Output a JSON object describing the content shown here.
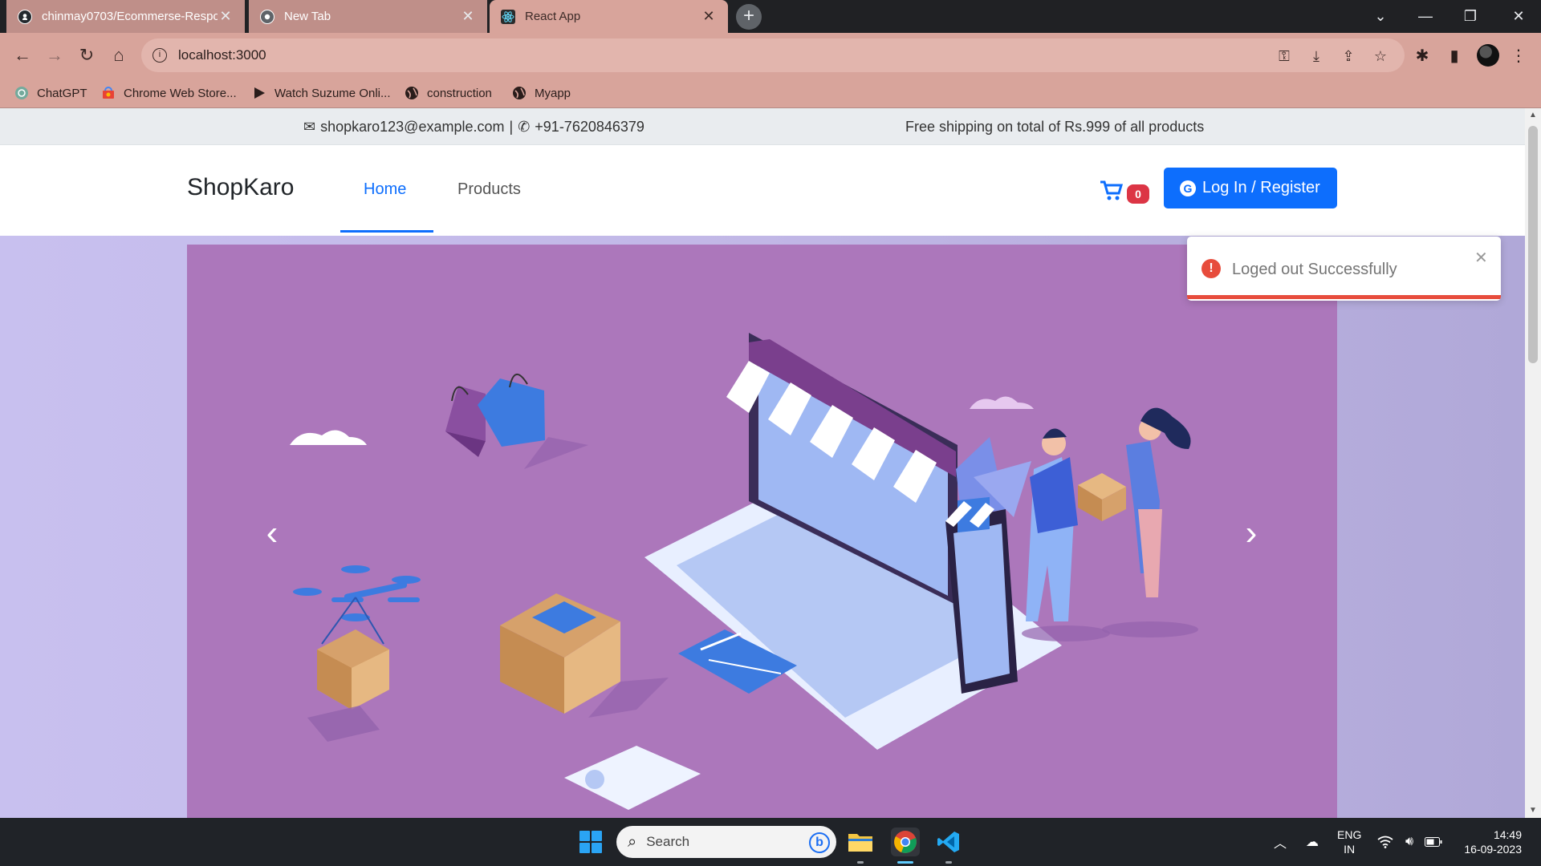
{
  "browser": {
    "tabs": [
      {
        "title": "chinmay0703/Ecommerse-Responsive",
        "close": "✕",
        "icon": "github-icon"
      },
      {
        "title": "New Tab",
        "close": "✕",
        "icon": "chrome-icon"
      },
      {
        "title": "React App",
        "close": "✕",
        "icon": "react-icon"
      }
    ],
    "new_tab": "+",
    "url": "localhost:3000",
    "bookmarks": [
      {
        "label": "ChatGPT",
        "icon": "chatgpt-icon"
      },
      {
        "label": "Chrome Web Store...",
        "icon": "webstore-icon"
      },
      {
        "label": "Watch Suzume Onli...",
        "icon": "play-icon"
      },
      {
        "label": "construction",
        "icon": "globe-icon"
      },
      {
        "label": "Myapp",
        "icon": "globe-icon"
      }
    ],
    "colors": {
      "tab_active": "#d8a49b",
      "tab_inactive": "#bf8f89",
      "frame": "#202124"
    }
  },
  "page": {
    "topbar": {
      "email": "shopkaro123@example.com",
      "separator": "|",
      "phone": "+91-7620846379",
      "shipping": "Free shipping on total of Rs.999 of all products"
    },
    "navbar": {
      "brand": "ShopKaro",
      "links": [
        {
          "label": "Home",
          "active": true
        },
        {
          "label": "Products",
          "active": false
        }
      ],
      "cart_count": "0",
      "login_label": "Log In / Register"
    },
    "carousel": {
      "prev": "‹",
      "next": "›"
    },
    "colors": {
      "primary": "#0d6efd",
      "danger": "#dc3545",
      "hero": "#ac77bb"
    }
  },
  "toast": {
    "message": "Loged out Successfully",
    "icon": "!",
    "close": "✕",
    "color": "#e74c3c"
  },
  "taskbar": {
    "search_placeholder": "Search",
    "lang_line1": "ENG",
    "lang_line2": "IN",
    "time": "14:49",
    "date": "16-09-2023"
  }
}
